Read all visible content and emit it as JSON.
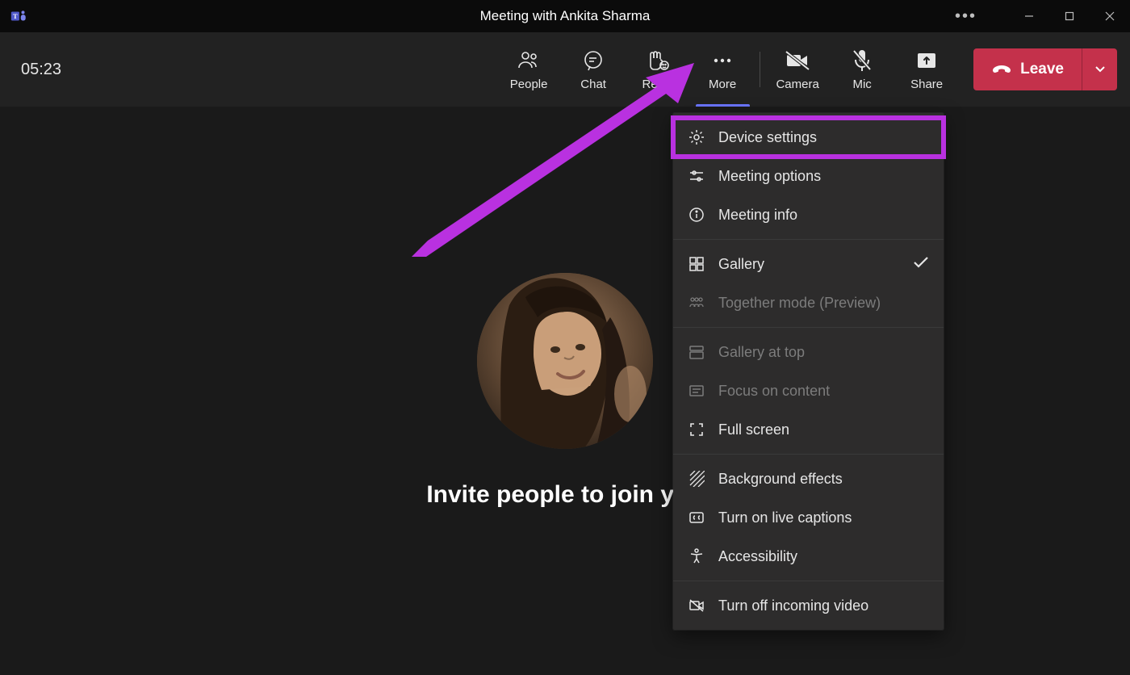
{
  "window": {
    "title": "Meeting with Ankita Sharma"
  },
  "toolbar": {
    "timer": "05:23",
    "buttons": {
      "people": "People",
      "chat": "Chat",
      "react": "React",
      "more": "More",
      "camera": "Camera",
      "mic": "Mic",
      "share": "Share"
    },
    "leave_label": "Leave"
  },
  "stage": {
    "invite_text": "Invite people to join you"
  },
  "more_menu": {
    "group1": [
      {
        "label": "Device settings"
      },
      {
        "label": "Meeting options"
      },
      {
        "label": "Meeting info"
      }
    ],
    "group2": [
      {
        "label": "Gallery",
        "checked": true
      },
      {
        "label": "Together mode (Preview)",
        "disabled": true
      }
    ],
    "group3": [
      {
        "label": "Gallery at top",
        "disabled": true
      },
      {
        "label": "Focus on content",
        "disabled": true
      },
      {
        "label": "Full screen"
      }
    ],
    "group4": [
      {
        "label": "Background effects"
      },
      {
        "label": "Turn on live captions"
      },
      {
        "label": "Accessibility"
      }
    ],
    "group5": [
      {
        "label": "Turn off incoming video"
      }
    ]
  },
  "annotation": {
    "highlight_item": "Device settings",
    "color": "#b931e0"
  }
}
